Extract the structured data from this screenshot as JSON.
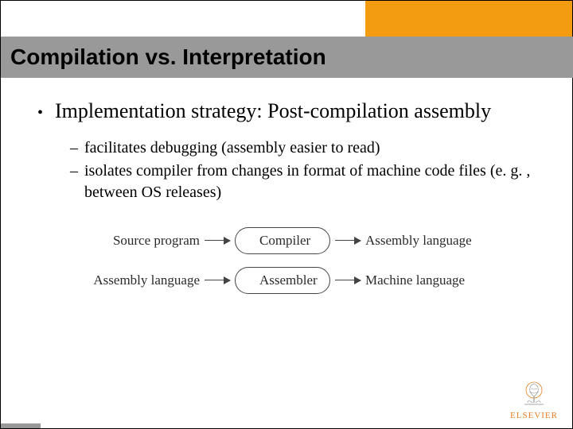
{
  "header": {
    "title": "Compilation vs. Interpretation"
  },
  "bullet": {
    "main": "Implementation strategy: Post-compilation assembly",
    "subs": [
      "facilitates debugging (assembly easier to read)",
      "isolates compiler from changes in format of machine code files (e. g. , between OS releases)"
    ]
  },
  "diagram": {
    "row1": {
      "input": "Source program",
      "process": "Compiler",
      "output": "Assembly language"
    },
    "row2": {
      "input": "Assembly language",
      "process": "Assembler",
      "output": "Machine language"
    }
  },
  "brand": {
    "name": "ELSEVIER"
  }
}
